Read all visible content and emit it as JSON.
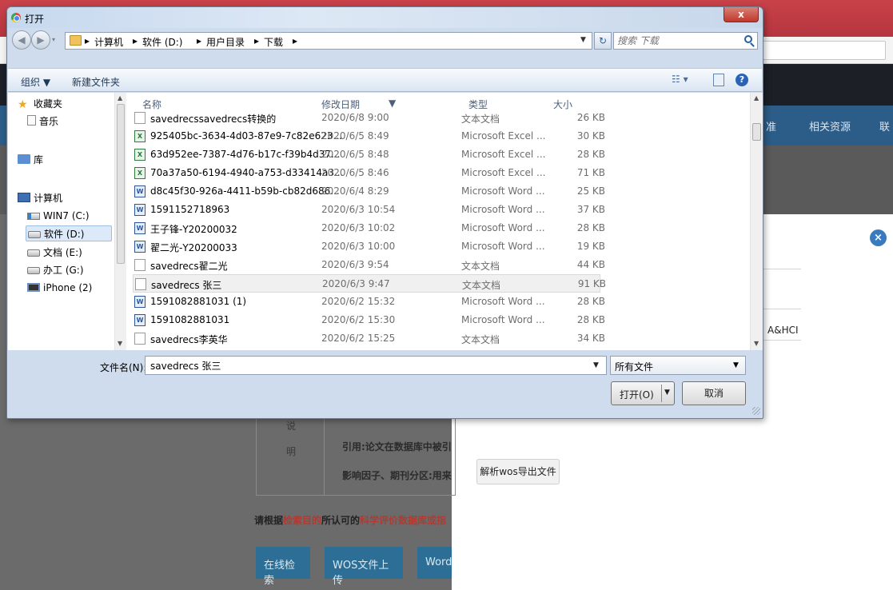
{
  "browser": {
    "tab_title": "打开",
    "nav": [
      "准",
      "相关资源",
      "联"
    ],
    "fragments": {
      "shuo": "说",
      "ming": "明",
      "cite": "引用:论文在数据库中被引",
      "impact": "影响因子、期刊分区:用来",
      "prompt_prefix": "请根据",
      "prompt_red": "检索目的",
      "prompt_mid": "所认可的",
      "prompt_red2": "科学评价数据库或指"
    },
    "ahci": "A&HCI",
    "parse_button": "解析wos导出文件",
    "bottom_buttons": [
      "在线检索",
      "WOS文件上传",
      "Word"
    ]
  },
  "dialog": {
    "title": "打开",
    "close_label": "x",
    "breadcrumb": [
      "计算机",
      "软件 (D:)",
      "用户目录",
      "下载"
    ],
    "search_placeholder": "搜索 下载",
    "toolbar": {
      "organize": "组织 ▼",
      "new_folder": "新建文件夹"
    },
    "nav_items": [
      {
        "label": "收藏夹",
        "icon": "star-icon"
      },
      {
        "label": "音乐",
        "icon": "music-folder-icon"
      },
      {
        "label": "库",
        "icon": "library-icon"
      },
      {
        "label": "计算机",
        "icon": "computer-icon"
      },
      {
        "label": "WIN7 (C:)",
        "icon": "windows-drive-icon"
      },
      {
        "label": "软件 (D:)",
        "icon": "drive-icon",
        "selected": true
      },
      {
        "label": "文档 (E:)",
        "icon": "drive-icon"
      },
      {
        "label": "办工 (G:)",
        "icon": "drive-icon"
      },
      {
        "label": "iPhone (2)",
        "icon": "phone-icon"
      }
    ],
    "columns": {
      "name": "名称",
      "date": "修改日期",
      "type": "类型",
      "size": "大小"
    },
    "files": [
      {
        "name": "savedrecssavedrecs转换的",
        "date": "2020/6/8 9:00",
        "type": "文本文档",
        "size": "26 KB",
        "kind": "text"
      },
      {
        "name": "925405bc-3634-4d03-87e9-7c82e623...",
        "date": "2020/6/5 8:49",
        "type": "Microsoft Excel ...",
        "size": "30 KB",
        "kind": "excel"
      },
      {
        "name": "63d952ee-7387-4d76-b17c-f39b4d37...",
        "date": "2020/6/5 8:48",
        "type": "Microsoft Excel ...",
        "size": "28 KB",
        "kind": "excel"
      },
      {
        "name": "70a37a50-6194-4940-a753-d33414a3...",
        "date": "2020/6/5 8:46",
        "type": "Microsoft Excel ...",
        "size": "71 KB",
        "kind": "excel"
      },
      {
        "name": "d8c45f30-926a-4411-b59b-cb82d686...",
        "date": "2020/6/4 8:29",
        "type": "Microsoft Word ...",
        "size": "25 KB",
        "kind": "word"
      },
      {
        "name": "1591152718963",
        "date": "2020/6/3 10:54",
        "type": "Microsoft Word ...",
        "size": "37 KB",
        "kind": "word"
      },
      {
        "name": "王子锋-Y20200032",
        "date": "2020/6/3 10:02",
        "type": "Microsoft Word ...",
        "size": "28 KB",
        "kind": "word"
      },
      {
        "name": "翟二光-Y20200033",
        "date": "2020/6/3 10:00",
        "type": "Microsoft Word ...",
        "size": "19 KB",
        "kind": "word"
      },
      {
        "name": "savedrecs翟二光",
        "date": "2020/6/3 9:54",
        "type": "文本文档",
        "size": "44 KB",
        "kind": "text"
      },
      {
        "name": "savedrecs 张三",
        "date": "2020/6/3 9:47",
        "type": "文本文档",
        "size": "91 KB",
        "kind": "text",
        "selected": true
      },
      {
        "name": "1591082881031 (1)",
        "date": "2020/6/2 15:32",
        "type": "Microsoft Word ...",
        "size": "28 KB",
        "kind": "word"
      },
      {
        "name": "1591082881031",
        "date": "2020/6/2 15:30",
        "type": "Microsoft Word ...",
        "size": "28 KB",
        "kind": "word"
      },
      {
        "name": "savedrecs李英华",
        "date": "2020/6/2 15:25",
        "type": "文本文档",
        "size": "34 KB",
        "kind": "text"
      }
    ],
    "filename_label": "文件名(N):",
    "filename_value": "savedrecs 张三",
    "filter_value": "所有文件",
    "open_label": "打开(O)",
    "cancel_label": "取消"
  }
}
